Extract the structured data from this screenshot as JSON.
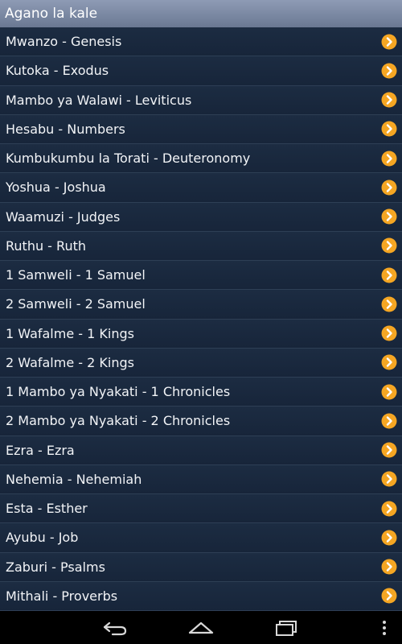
{
  "header": {
    "title": "Agano la kale"
  },
  "books": [
    {
      "label": "Mwanzo - Genesis"
    },
    {
      "label": "Kutoka - Exodus"
    },
    {
      "label": "Mambo ya Walawi - Leviticus"
    },
    {
      "label": "Hesabu - Numbers"
    },
    {
      "label": "Kumbukumbu la Torati - Deuteronomy"
    },
    {
      "label": "Yoshua - Joshua"
    },
    {
      "label": "Waamuzi - Judges"
    },
    {
      "label": "Ruthu - Ruth"
    },
    {
      "label": "1 Samweli - 1 Samuel"
    },
    {
      "label": "2 Samweli - 2 Samuel"
    },
    {
      "label": "1 Wafalme - 1 Kings"
    },
    {
      "label": "2 Wafalme - 2 Kings"
    },
    {
      "label": "1 Mambo ya Nyakati - 1 Chronicles"
    },
    {
      "label": "2 Mambo ya Nyakati - 2 Chronicles"
    },
    {
      "label": "Ezra - Ezra"
    },
    {
      "label": "Nehemia - Nehemiah"
    },
    {
      "label": "Esta - Esther"
    },
    {
      "label": "Ayubu - Job"
    },
    {
      "label": "Zaburi - Psalms"
    },
    {
      "label": "Mithali - Proverbs"
    }
  ],
  "icons": {
    "row_chevron": "chevron-right-circle-icon",
    "nav_back": "back-icon",
    "nav_home": "home-icon",
    "nav_recents": "recent-apps-icon",
    "nav_menu": "overflow-menu-icon"
  },
  "colors": {
    "background": "#1b2a3e",
    "header": "#7d8aa4",
    "chevron": "#f5a623",
    "text": "#f2f4f7"
  }
}
